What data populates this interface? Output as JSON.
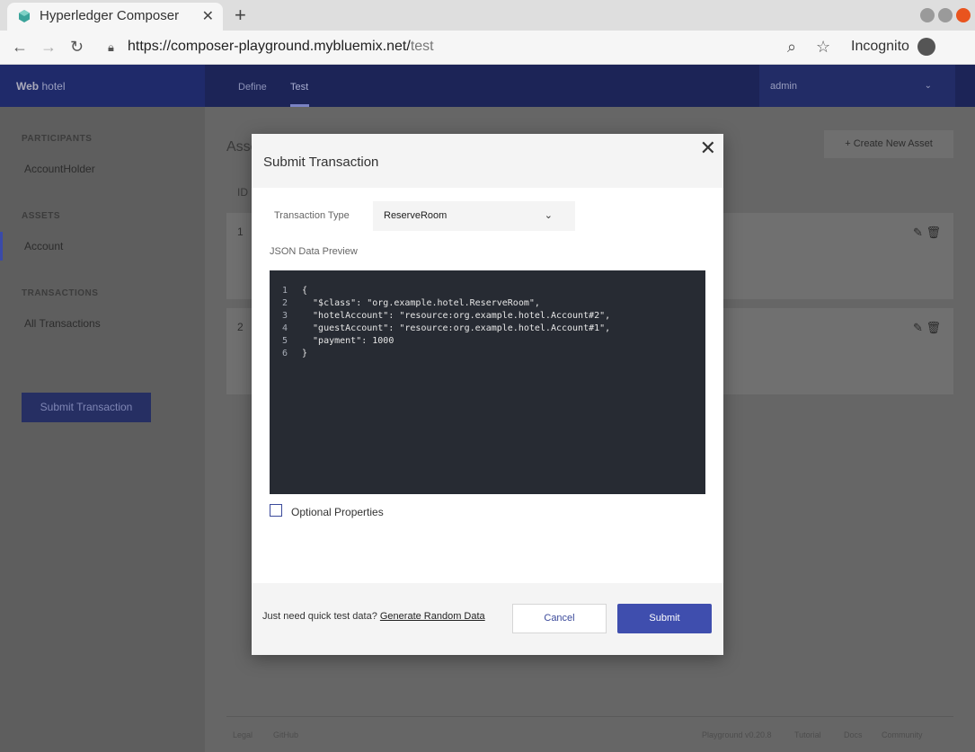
{
  "browser": {
    "tab_title": "Hyperledger Composer",
    "url_main": "https://composer-playground.mybluemix.net/",
    "url_path": "test",
    "incognito_label": "Incognito"
  },
  "app": {
    "brand_bold": "Web",
    "brand_name": "hotel",
    "nav": [
      "Define",
      "Test"
    ],
    "active_nav": "Test",
    "user": "admin"
  },
  "sidebar": {
    "participants_heading": "PARTICIPANTS",
    "participants": [
      "AccountHolder"
    ],
    "assets_heading": "ASSETS",
    "assets": [
      "Account"
    ],
    "transactions_heading": "TRANSACTIONS",
    "transactions": [
      "All Transactions"
    ],
    "submit_label": "Submit Transaction"
  },
  "main": {
    "title": "Asse",
    "create_label": "+ Create New Asset",
    "id_header": "ID",
    "asset_ids": [
      "1",
      "2"
    ],
    "footer_left": [
      "Legal",
      "GitHub"
    ],
    "footer_right": [
      "Playground v0.20.8",
      "Tutorial",
      "Docs",
      "Community"
    ]
  },
  "modal": {
    "title": "Submit Transaction",
    "tx_type_label": "Transaction Type",
    "tx_type_value": "ReserveRoom",
    "json_label": "JSON Data Preview",
    "json_lines": [
      {
        "n": "1",
        "text": "{"
      },
      {
        "n": "2",
        "text": "  \"$class\": \"org.example.hotel.ReserveRoom\","
      },
      {
        "n": "3",
        "text": "  \"hotelAccount\": \"resource:org.example.hotel.Account#2\","
      },
      {
        "n": "4",
        "text": "  \"guestAccount\": \"resource:org.example.hotel.Account#1\","
      },
      {
        "n": "5",
        "text": "  \"payment\": 1000"
      },
      {
        "n": "6",
        "text": "}"
      }
    ],
    "optional_label": "Optional Properties",
    "quick_text": "Just need quick test data?",
    "generate_link": "Generate Random Data",
    "cancel_label": "Cancel",
    "submit_label": "Submit"
  }
}
